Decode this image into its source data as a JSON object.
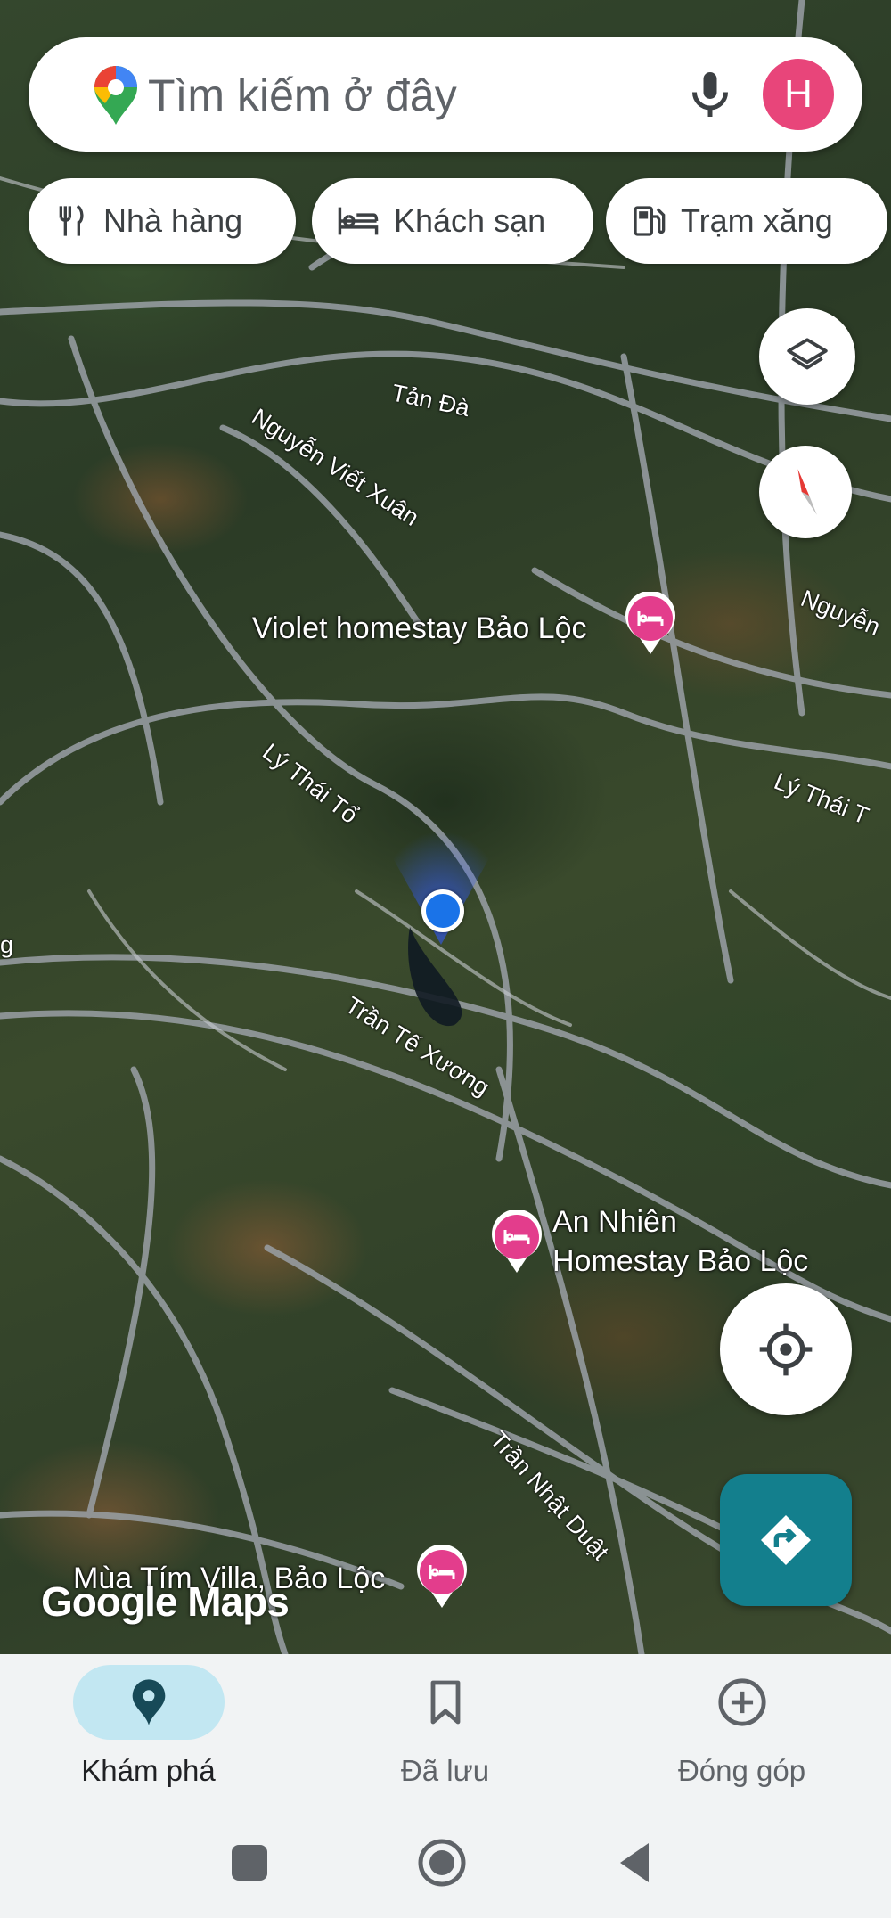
{
  "search": {
    "placeholder": "Tìm kiếm ở đây",
    "avatar_letter": "H"
  },
  "chips": [
    {
      "label": "Nhà hàng",
      "icon": "restaurant-icon"
    },
    {
      "label": "Khách sạn",
      "icon": "hotel-icon"
    },
    {
      "label": "Trạm xăng",
      "icon": "gas-station-icon"
    }
  ],
  "map": {
    "places": [
      {
        "name": "Violet homestay Bảo Lộc"
      },
      {
        "name_line1": "An Nhiên",
        "name_line2": "Homestay Bảo Lộc"
      },
      {
        "name": "Mùa Tím Villa, Bảo Lộc"
      }
    ],
    "streets": {
      "tan_da": "Tản Đà",
      "nguyen_viet_xuan": "Nguyễn Viết Xuân",
      "nguyen_right": "Nguyễn",
      "ly_thai_to": "Lý Thái Tổ",
      "ly_thai_right": "Lý Thái T",
      "tran_te_xuong": "Trần Tế Xương",
      "tran_nhat_duat": "Trần Nhật Duật",
      "edge_g": "g"
    },
    "watermark": "Google Maps"
  },
  "bottom_nav": {
    "items": [
      {
        "label": "Khám phá",
        "icon": "explore-pin-icon",
        "active": true
      },
      {
        "label": "Đã lưu",
        "icon": "bookmark-icon",
        "active": false
      },
      {
        "label": "Đóng góp",
        "icon": "add-circle-icon",
        "active": false
      }
    ]
  },
  "colors": {
    "accent": "#137f8d",
    "poi": "#e33d8c",
    "location": "#1a73e8",
    "avatar": "#e8457a",
    "nav_active_bg": "#c2e7f2"
  }
}
